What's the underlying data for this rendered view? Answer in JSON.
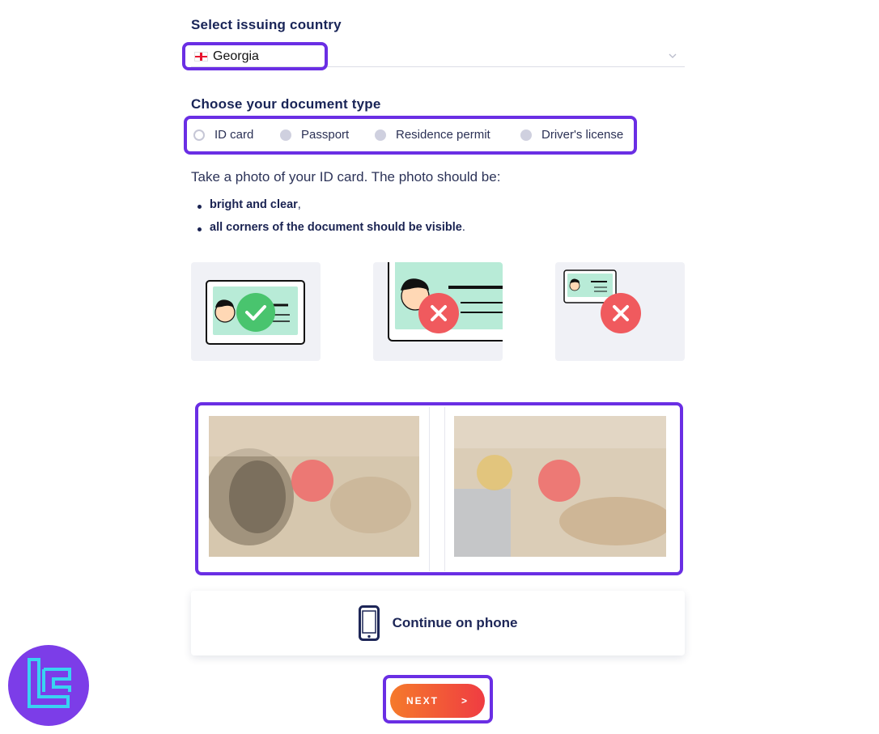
{
  "country_section": {
    "heading": "Select issuing country",
    "selected_value": "Georgia",
    "flag_icon": "georgia-flag-icon",
    "dropdown_icon": "chevron-down-icon"
  },
  "doctype_section": {
    "heading": "Choose your document type",
    "options": [
      {
        "label": "ID card",
        "selected": true
      },
      {
        "label": "Passport",
        "selected": false
      },
      {
        "label": "Residence permit",
        "selected": false
      },
      {
        "label": "Driver's license",
        "selected": false
      }
    ]
  },
  "instructions": {
    "text": "Take a photo of your ID card. The photo should be:",
    "bullets": [
      {
        "bold": "bright and clear",
        "tail": ","
      },
      {
        "bold": "all corners of the document should be visible",
        "tail": "."
      }
    ]
  },
  "examples": [
    {
      "status": "correct",
      "icon": "check-icon"
    },
    {
      "status": "too-close",
      "icon": "cross-icon"
    },
    {
      "status": "too-far",
      "icon": "cross-icon"
    }
  ],
  "uploads": {
    "front_photo": "blurred-document-photo",
    "back_photo": "blurred-document-photo"
  },
  "continue_phone": {
    "label": "Continue on phone",
    "icon": "smartphone-icon"
  },
  "next_button": {
    "label": "NEXT",
    "arrow": ">"
  },
  "colors": {
    "highlight": "#6a2ee4",
    "heading": "#182457",
    "button_start": "#f57a2b",
    "button_end": "#ef3c42",
    "card_mint": "#b8ebd7",
    "success": "#49c46e",
    "error": "#f05a5e"
  }
}
